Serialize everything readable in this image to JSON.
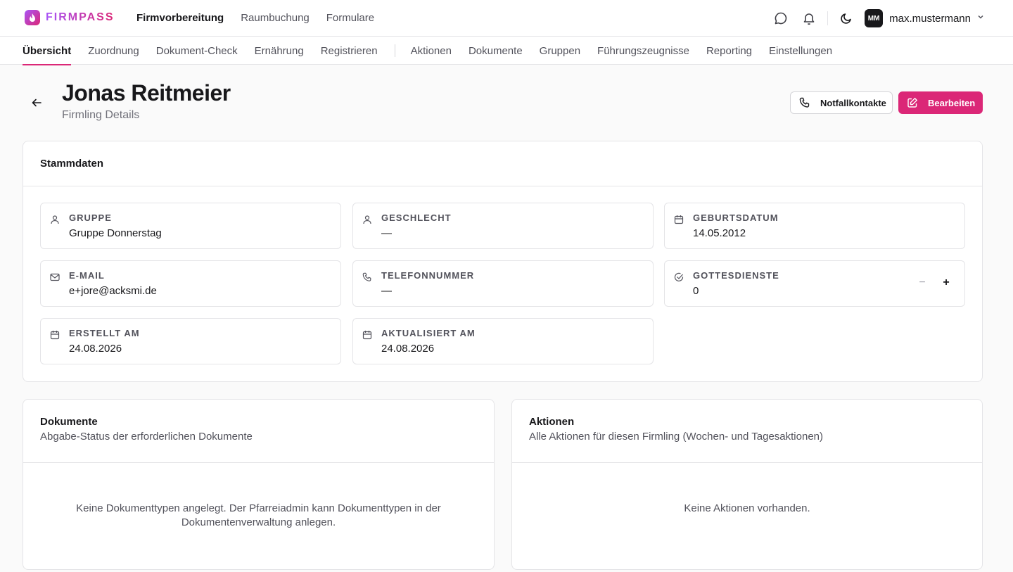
{
  "brand": {
    "name": "FIRMPASS"
  },
  "main_nav": [
    "Firmvorbereitung",
    "Raumbuchung",
    "Formulare"
  ],
  "user": {
    "initials": "MM",
    "name": "max.mustermann"
  },
  "sub_nav": {
    "group1": [
      "Übersicht",
      "Zuordnung",
      "Dokument-Check",
      "Ernährung",
      "Registrieren"
    ],
    "group2": [
      "Aktionen",
      "Dokumente",
      "Gruppen",
      "Führungszeugnisse",
      "Reporting",
      "Einstellungen"
    ]
  },
  "header": {
    "title": "Jonas Reitmeier",
    "subtitle": "Firmling Details",
    "emergency_button": "Notfallkontakte",
    "edit_button": "Bearbeiten"
  },
  "stammdaten": {
    "title": "Stammdaten",
    "fields": [
      {
        "label": "GRUPPE",
        "value": "Gruppe Donnerstag",
        "icon": "user-icon"
      },
      {
        "label": "GESCHLECHT",
        "value": "—",
        "icon": "user-icon"
      },
      {
        "label": "GEBURTSDATUM",
        "value": "14.05.2012",
        "icon": "calendar-icon"
      },
      {
        "label": "E-MAIL",
        "value": "e+jore@acksmi.de",
        "icon": "mail-icon"
      },
      {
        "label": "TELEFONNUMMER",
        "value": "—",
        "icon": "phone-icon"
      },
      {
        "label": "GOTTESDIENSTE",
        "value": "0",
        "icon": "check-circle-icon",
        "decrement": "−",
        "increment": "+"
      },
      {
        "label": "ERSTELLT AM",
        "value": "24.08.2026",
        "icon": "calendar-icon"
      },
      {
        "label": "AKTUALISIERT AM",
        "value": "24.08.2026",
        "icon": "calendar-icon"
      }
    ]
  },
  "documents": {
    "title": "Dokumente",
    "description": "Abgabe-Status der erforderlichen Dokumente",
    "empty_line1": "Keine Dokumenttypen angelegt. Der Pfarreiadmin kann Dokumenttypen in der",
    "empty_line2": "Dokumentenverwaltung anlegen."
  },
  "actions": {
    "title": "Aktionen",
    "description": "Alle Aktionen für diesen Firmling (Wochen- und Tagesaktionen)",
    "empty": "Keine Aktionen vorhanden."
  },
  "colors": {
    "accent": "#db2777",
    "brand_start": "#a855f7"
  }
}
